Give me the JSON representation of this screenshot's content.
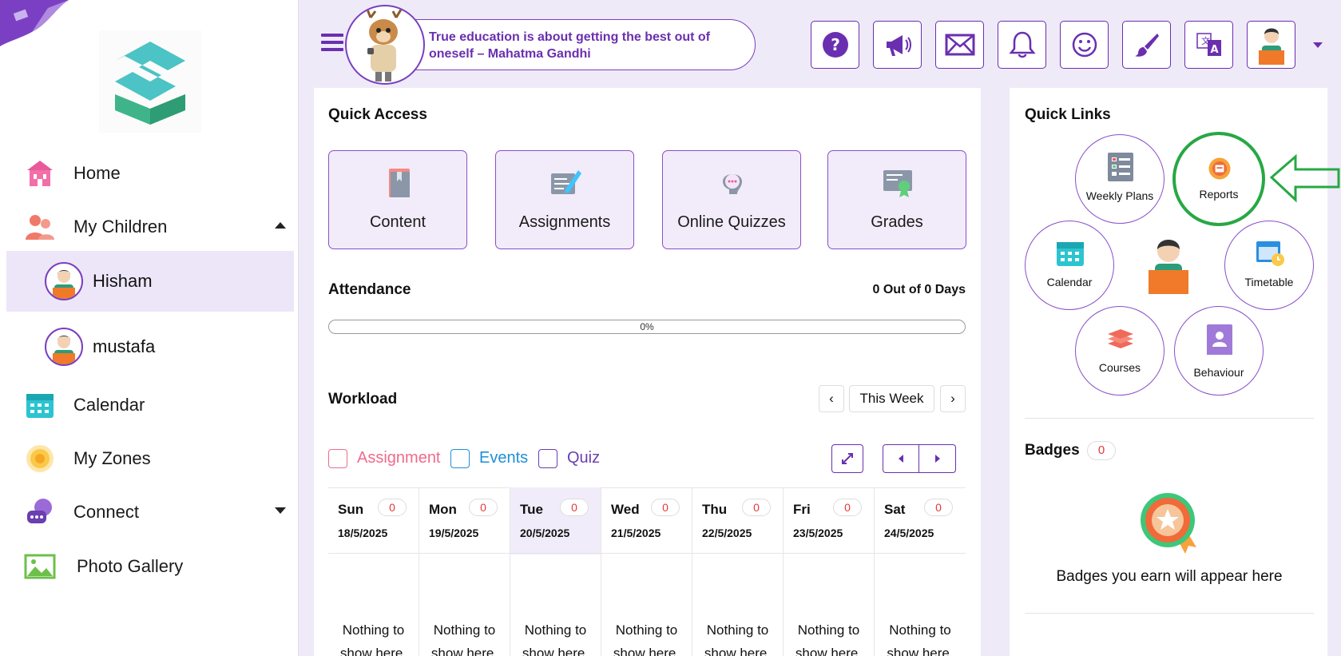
{
  "sidebar": {
    "items": [
      {
        "label": "Home",
        "icon": "home-icon"
      },
      {
        "label": "My Children",
        "icon": "children-icon"
      },
      {
        "label": "Calendar",
        "icon": "calendar-icon"
      },
      {
        "label": "My Zones",
        "icon": "zones-icon"
      },
      {
        "label": "Connect",
        "icon": "connect-icon"
      },
      {
        "label": "Photo Gallery",
        "icon": "photo-gallery-icon"
      }
    ],
    "children": [
      {
        "name": "Hisham",
        "active": true
      },
      {
        "name": "mustafa",
        "active": false
      }
    ]
  },
  "header": {
    "quote": "True education is about getting the best out of oneself – Mahatma Gandhi",
    "buttons": [
      "help-icon",
      "announcement-icon",
      "mail-icon",
      "bell-icon",
      "smiley-icon",
      "paintbrush-icon",
      "translate-icon",
      "profile-avatar"
    ]
  },
  "quick_access": {
    "title": "Quick Access",
    "tiles": [
      {
        "label": "Content",
        "icon": "book-icon"
      },
      {
        "label": "Assignments",
        "icon": "assignment-icon"
      },
      {
        "label": "Online Quizzes",
        "icon": "quiz-icon"
      },
      {
        "label": "Grades",
        "icon": "certificate-icon"
      }
    ]
  },
  "attendance": {
    "title": "Attendance",
    "days_text": "0 Out of 0 Days",
    "percent_text": "0%",
    "percent": 0
  },
  "workload": {
    "title": "Workload",
    "week_label": "This Week",
    "legend": [
      {
        "label": "Assignment",
        "color": "#ef6b8c"
      },
      {
        "label": "Events",
        "color": "#1f8fd6"
      },
      {
        "label": "Quiz",
        "color": "#6a3fb0"
      }
    ],
    "empty_text_1": "Nothing to",
    "empty_text_2": "show here.",
    "days": [
      {
        "name": "Sun",
        "date": "18/5/2025",
        "count": "0",
        "today": false
      },
      {
        "name": "Mon",
        "date": "19/5/2025",
        "count": "0",
        "today": false
      },
      {
        "name": "Tue",
        "date": "20/5/2025",
        "count": "0",
        "today": true
      },
      {
        "name": "Wed",
        "date": "21/5/2025",
        "count": "0",
        "today": false
      },
      {
        "name": "Thu",
        "date": "22/5/2025",
        "count": "0",
        "today": false
      },
      {
        "name": "Fri",
        "date": "23/5/2025",
        "count": "0",
        "today": false
      },
      {
        "name": "Sat",
        "date": "24/5/2025",
        "count": "0",
        "today": false
      }
    ]
  },
  "quick_links": {
    "title": "Quick Links",
    "items": {
      "weekly_plans": "Weekly Plans",
      "reports": "Reports",
      "calendar": "Calendar",
      "timetable": "Timetable",
      "courses": "Courses",
      "behaviour": "Behaviour"
    }
  },
  "badges": {
    "title": "Badges",
    "count": "0",
    "empty_text": "Badges you earn will appear here"
  },
  "colors": {
    "brand_purple": "#6a2fb0",
    "highlight_green": "#27a844",
    "count_red": "#e53935"
  }
}
